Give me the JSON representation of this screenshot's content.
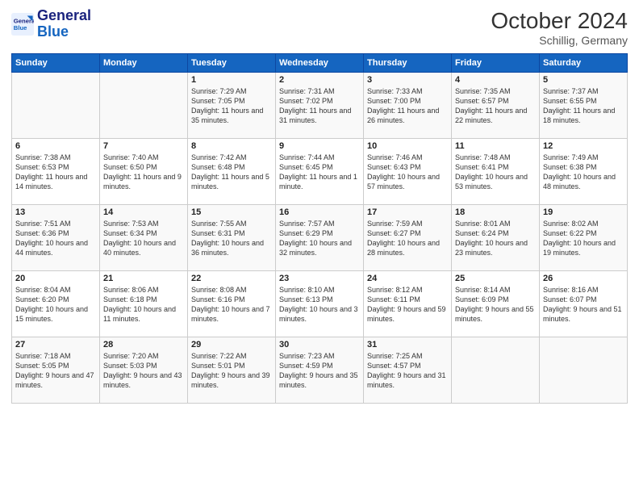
{
  "logo": {
    "line1": "General",
    "line2": "Blue"
  },
  "title": "October 2024",
  "subtitle": "Schillig, Germany",
  "weekdays": [
    "Sunday",
    "Monday",
    "Tuesday",
    "Wednesday",
    "Thursday",
    "Friday",
    "Saturday"
  ],
  "weeks": [
    [
      {
        "day": "",
        "sunrise": "",
        "sunset": "",
        "daylight": ""
      },
      {
        "day": "",
        "sunrise": "",
        "sunset": "",
        "daylight": ""
      },
      {
        "day": "1",
        "sunrise": "Sunrise: 7:29 AM",
        "sunset": "Sunset: 7:05 PM",
        "daylight": "Daylight: 11 hours and 35 minutes."
      },
      {
        "day": "2",
        "sunrise": "Sunrise: 7:31 AM",
        "sunset": "Sunset: 7:02 PM",
        "daylight": "Daylight: 11 hours and 31 minutes."
      },
      {
        "day": "3",
        "sunrise": "Sunrise: 7:33 AM",
        "sunset": "Sunset: 7:00 PM",
        "daylight": "Daylight: 11 hours and 26 minutes."
      },
      {
        "day": "4",
        "sunrise": "Sunrise: 7:35 AM",
        "sunset": "Sunset: 6:57 PM",
        "daylight": "Daylight: 11 hours and 22 minutes."
      },
      {
        "day": "5",
        "sunrise": "Sunrise: 7:37 AM",
        "sunset": "Sunset: 6:55 PM",
        "daylight": "Daylight: 11 hours and 18 minutes."
      }
    ],
    [
      {
        "day": "6",
        "sunrise": "Sunrise: 7:38 AM",
        "sunset": "Sunset: 6:53 PM",
        "daylight": "Daylight: 11 hours and 14 minutes."
      },
      {
        "day": "7",
        "sunrise": "Sunrise: 7:40 AM",
        "sunset": "Sunset: 6:50 PM",
        "daylight": "Daylight: 11 hours and 9 minutes."
      },
      {
        "day": "8",
        "sunrise": "Sunrise: 7:42 AM",
        "sunset": "Sunset: 6:48 PM",
        "daylight": "Daylight: 11 hours and 5 minutes."
      },
      {
        "day": "9",
        "sunrise": "Sunrise: 7:44 AM",
        "sunset": "Sunset: 6:45 PM",
        "daylight": "Daylight: 11 hours and 1 minute."
      },
      {
        "day": "10",
        "sunrise": "Sunrise: 7:46 AM",
        "sunset": "Sunset: 6:43 PM",
        "daylight": "Daylight: 10 hours and 57 minutes."
      },
      {
        "day": "11",
        "sunrise": "Sunrise: 7:48 AM",
        "sunset": "Sunset: 6:41 PM",
        "daylight": "Daylight: 10 hours and 53 minutes."
      },
      {
        "day": "12",
        "sunrise": "Sunrise: 7:49 AM",
        "sunset": "Sunset: 6:38 PM",
        "daylight": "Daylight: 10 hours and 48 minutes."
      }
    ],
    [
      {
        "day": "13",
        "sunrise": "Sunrise: 7:51 AM",
        "sunset": "Sunset: 6:36 PM",
        "daylight": "Daylight: 10 hours and 44 minutes."
      },
      {
        "day": "14",
        "sunrise": "Sunrise: 7:53 AM",
        "sunset": "Sunset: 6:34 PM",
        "daylight": "Daylight: 10 hours and 40 minutes."
      },
      {
        "day": "15",
        "sunrise": "Sunrise: 7:55 AM",
        "sunset": "Sunset: 6:31 PM",
        "daylight": "Daylight: 10 hours and 36 minutes."
      },
      {
        "day": "16",
        "sunrise": "Sunrise: 7:57 AM",
        "sunset": "Sunset: 6:29 PM",
        "daylight": "Daylight: 10 hours and 32 minutes."
      },
      {
        "day": "17",
        "sunrise": "Sunrise: 7:59 AM",
        "sunset": "Sunset: 6:27 PM",
        "daylight": "Daylight: 10 hours and 28 minutes."
      },
      {
        "day": "18",
        "sunrise": "Sunrise: 8:01 AM",
        "sunset": "Sunset: 6:24 PM",
        "daylight": "Daylight: 10 hours and 23 minutes."
      },
      {
        "day": "19",
        "sunrise": "Sunrise: 8:02 AM",
        "sunset": "Sunset: 6:22 PM",
        "daylight": "Daylight: 10 hours and 19 minutes."
      }
    ],
    [
      {
        "day": "20",
        "sunrise": "Sunrise: 8:04 AM",
        "sunset": "Sunset: 6:20 PM",
        "daylight": "Daylight: 10 hours and 15 minutes."
      },
      {
        "day": "21",
        "sunrise": "Sunrise: 8:06 AM",
        "sunset": "Sunset: 6:18 PM",
        "daylight": "Daylight: 10 hours and 11 minutes."
      },
      {
        "day": "22",
        "sunrise": "Sunrise: 8:08 AM",
        "sunset": "Sunset: 6:16 PM",
        "daylight": "Daylight: 10 hours and 7 minutes."
      },
      {
        "day": "23",
        "sunrise": "Sunrise: 8:10 AM",
        "sunset": "Sunset: 6:13 PM",
        "daylight": "Daylight: 10 hours and 3 minutes."
      },
      {
        "day": "24",
        "sunrise": "Sunrise: 8:12 AM",
        "sunset": "Sunset: 6:11 PM",
        "daylight": "Daylight: 9 hours and 59 minutes."
      },
      {
        "day": "25",
        "sunrise": "Sunrise: 8:14 AM",
        "sunset": "Sunset: 6:09 PM",
        "daylight": "Daylight: 9 hours and 55 minutes."
      },
      {
        "day": "26",
        "sunrise": "Sunrise: 8:16 AM",
        "sunset": "Sunset: 6:07 PM",
        "daylight": "Daylight: 9 hours and 51 minutes."
      }
    ],
    [
      {
        "day": "27",
        "sunrise": "Sunrise: 7:18 AM",
        "sunset": "Sunset: 5:05 PM",
        "daylight": "Daylight: 9 hours and 47 minutes."
      },
      {
        "day": "28",
        "sunrise": "Sunrise: 7:20 AM",
        "sunset": "Sunset: 5:03 PM",
        "daylight": "Daylight: 9 hours and 43 minutes."
      },
      {
        "day": "29",
        "sunrise": "Sunrise: 7:22 AM",
        "sunset": "Sunset: 5:01 PM",
        "daylight": "Daylight: 9 hours and 39 minutes."
      },
      {
        "day": "30",
        "sunrise": "Sunrise: 7:23 AM",
        "sunset": "Sunset: 4:59 PM",
        "daylight": "Daylight: 9 hours and 35 minutes."
      },
      {
        "day": "31",
        "sunrise": "Sunrise: 7:25 AM",
        "sunset": "Sunset: 4:57 PM",
        "daylight": "Daylight: 9 hours and 31 minutes."
      },
      {
        "day": "",
        "sunrise": "",
        "sunset": "",
        "daylight": ""
      },
      {
        "day": "",
        "sunrise": "",
        "sunset": "",
        "daylight": ""
      }
    ]
  ]
}
